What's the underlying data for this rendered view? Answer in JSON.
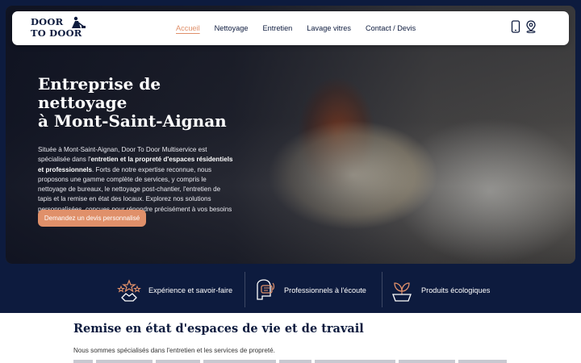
{
  "brand": {
    "line1": "DOOR",
    "line2": "TO DOOR"
  },
  "nav": {
    "items": [
      {
        "label": "Accueil",
        "active": true
      },
      {
        "label": "Nettoyage",
        "active": false
      },
      {
        "label": "Entretien",
        "active": false
      },
      {
        "label": "Lavage vitres",
        "active": false
      },
      {
        "label": "Contact / Devis",
        "active": false
      }
    ],
    "icons": [
      "phone-icon",
      "location-pin-icon"
    ]
  },
  "hero": {
    "title_line1": "Entreprise de nettoyage",
    "title_line2": "à Mont-Saint-Aignan",
    "text_part1": "Située à Mont-Saint-Aignan, Door To Door Multiservice est spécialisée dans l'",
    "text_bold": "entretien et la propreté d'espaces résidentiels et professionnels",
    "text_part2": ". Forts de notre expertise reconnue, nous proposons une gamme complète de services, y compris le nettoyage de bureaux, le nettoyage post-chantier, l'entretien de tapis et la remise en état des locaux. Explorez nos solutions personnalisées, conçues pour répondre précisément à vos besoins de propreté et d'hygiène.",
    "cta_label": "Demandez un devis personnalisé"
  },
  "features": [
    {
      "label": "Expérience et savoir-faire",
      "icon": "award-stars-icon"
    },
    {
      "label": "Professionnels à l'écoute",
      "icon": "listening-chat-icon"
    },
    {
      "label": "Produits écologiques",
      "icon": "eco-leaf-icon"
    }
  ],
  "section": {
    "title": "Remise en état d'espaces de vie et de travail",
    "text": "Nous sommes spécialisés dans l'entretien et les services de propreté."
  },
  "colors": {
    "navy": "#0d1b3e",
    "accent": "#e0906a",
    "white": "#ffffff"
  }
}
